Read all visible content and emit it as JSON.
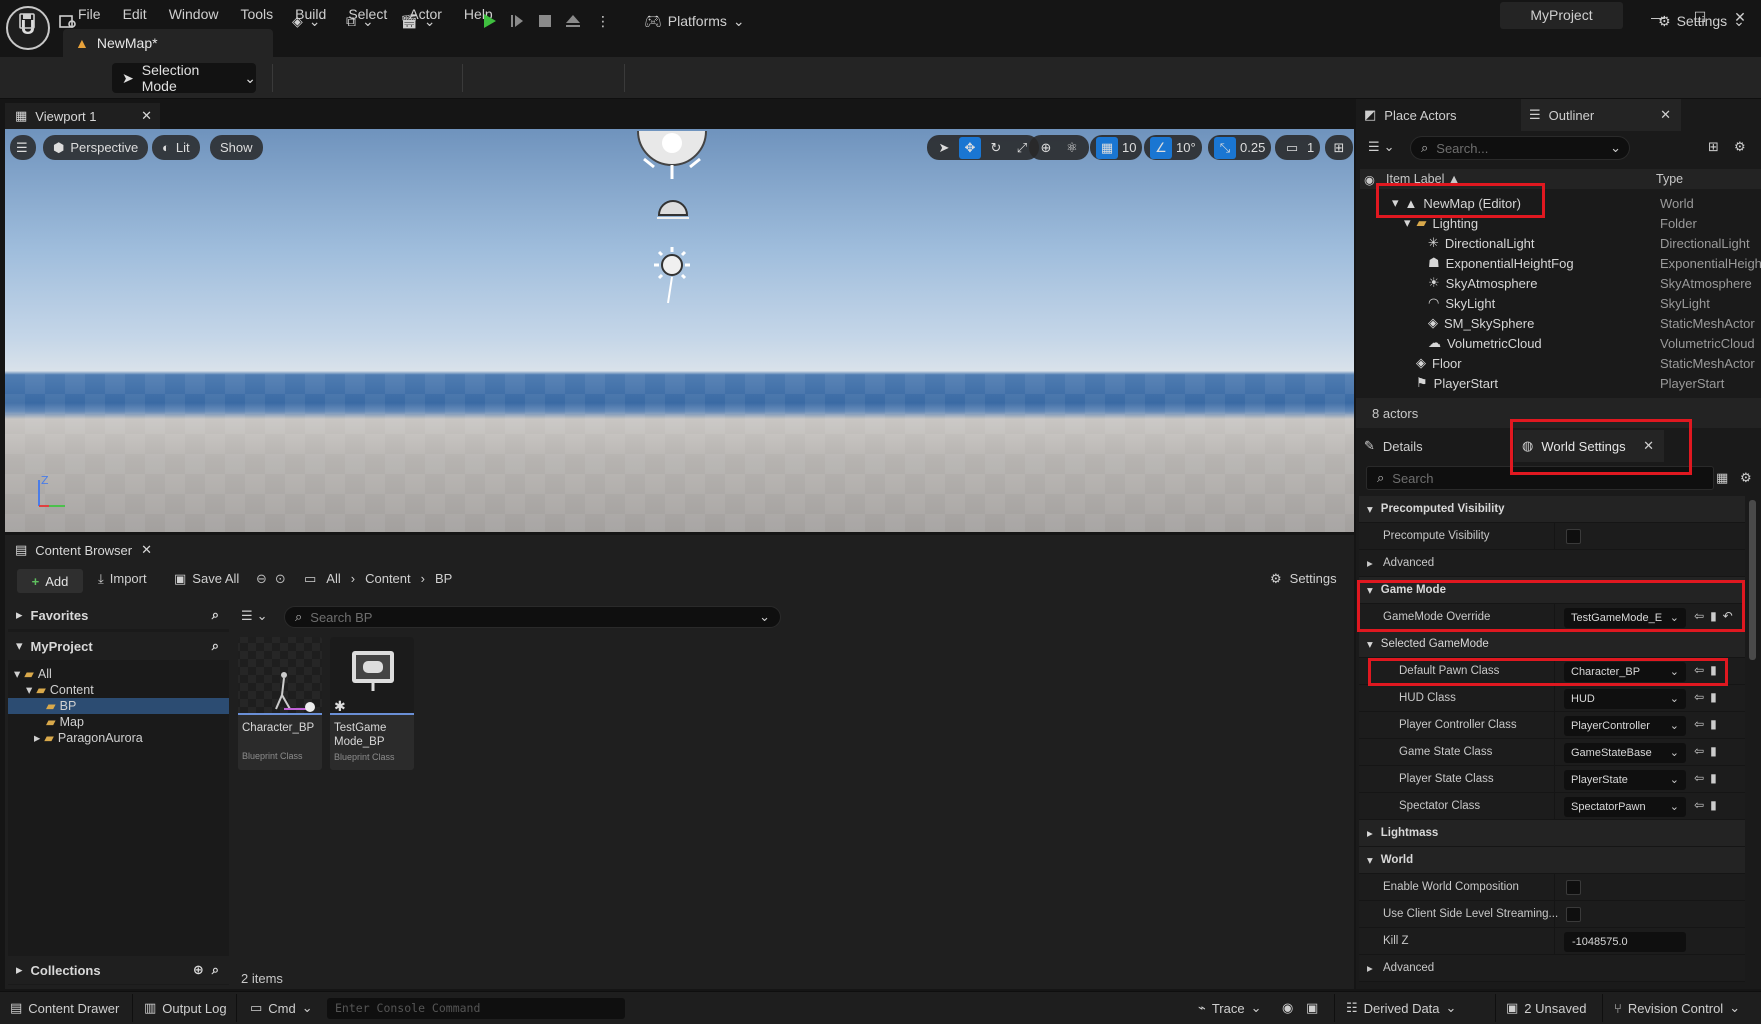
{
  "app": {
    "project_name": "MyProject",
    "doc_tab": "NewMap*",
    "menu": [
      "File",
      "Edit",
      "Window",
      "Tools",
      "Build",
      "Select",
      "Actor",
      "Help"
    ]
  },
  "toolbar": {
    "selection_mode": "Selection Mode",
    "platforms": "Platforms",
    "settings": "Settings"
  },
  "viewport": {
    "tab": "Viewport 1",
    "perspective": "Perspective",
    "lit": "Lit",
    "show": "Show",
    "grid_snap": "10",
    "rot_snap": "10°",
    "scale_snap": "0.25",
    "camera_speed": "1"
  },
  "content_browser": {
    "tab": "Content Browser",
    "add": "Add",
    "import": "Import",
    "save_all": "Save All",
    "breadcrumb": [
      "All",
      "Content",
      "BP"
    ],
    "settings": "Settings",
    "favorites": "Favorites",
    "project": "MyProject",
    "tree": [
      {
        "label": "All",
        "depth": 0
      },
      {
        "label": "Content",
        "depth": 1
      },
      {
        "label": "BP",
        "depth": 2
      },
      {
        "label": "Map",
        "depth": 2
      },
      {
        "label": "ParagonAurora",
        "depth": 2
      }
    ],
    "search_placeholder": "Search BP",
    "assets": [
      {
        "name": "Character_BP",
        "kind": "Blueprint Class"
      },
      {
        "name": "TestGame Mode_BP",
        "kind": "Blueprint Class"
      }
    ],
    "collections": "Collections",
    "item_count": "2 items"
  },
  "outliner": {
    "place_actors_tab": "Place Actors",
    "tab": "Outliner",
    "search_placeholder": "Search...",
    "col_label": "Item Label ▲",
    "col_type": "Type",
    "rows": [
      {
        "label": "NewMap (Editor)",
        "type": "World"
      },
      {
        "label": "Lighting",
        "type": "Folder"
      },
      {
        "label": "DirectionalLight",
        "type": "DirectionalLight"
      },
      {
        "label": "ExponentialHeightFog",
        "type": "ExponentialHeigh"
      },
      {
        "label": "SkyAtmosphere",
        "type": "SkyAtmosphere"
      },
      {
        "label": "SkyLight",
        "type": "SkyLight"
      },
      {
        "label": "SM_SkySphere",
        "type": "StaticMeshActor"
      },
      {
        "label": "VolumetricCloud",
        "type": "VolumetricCloud"
      },
      {
        "label": "Floor",
        "type": "StaticMeshActor"
      },
      {
        "label": "PlayerStart",
        "type": "PlayerStart"
      }
    ],
    "actor_count": "8 actors"
  },
  "details": {
    "details_tab": "Details",
    "world_settings_tab": "World Settings",
    "search_placeholder": "Search",
    "precomputed_visibility": "Precomputed Visibility",
    "precompute_visibility": "Precompute Visibility",
    "advanced": "Advanced",
    "game_mode": "Game Mode",
    "gamemode_override": "GameMode Override",
    "gamemode_override_value": "TestGameMode_E",
    "selected_gamemode": "Selected GameMode",
    "classes": [
      {
        "label": "Default Pawn Class",
        "value": "Character_BP"
      },
      {
        "label": "HUD Class",
        "value": "HUD"
      },
      {
        "label": "Player Controller Class",
        "value": "PlayerController"
      },
      {
        "label": "Game State Class",
        "value": "GameStateBase"
      },
      {
        "label": "Player State Class",
        "value": "PlayerState"
      },
      {
        "label": "Spectator Class",
        "value": "SpectatorPawn"
      }
    ],
    "lightmass": "Lightmass",
    "world": "World",
    "enable_world_composition": "Enable World Composition",
    "use_client_side": "Use Client Side Level Streaming...",
    "kill_z": "Kill Z",
    "kill_z_value": "-1048575.0",
    "advanced2": "Advanced"
  },
  "statusbar": {
    "content_drawer": "Content Drawer",
    "output_log": "Output Log",
    "cmd": "Cmd",
    "console_placeholder": "Enter Console Command",
    "trace": "Trace",
    "derived_data": "Derived Data",
    "unsaved": "2 Unsaved",
    "revision_control": "Revision Control"
  },
  "colors": {
    "highlight": "#e01820",
    "accent_blue": "#1a76d2",
    "play_green": "#3fbf3f"
  }
}
